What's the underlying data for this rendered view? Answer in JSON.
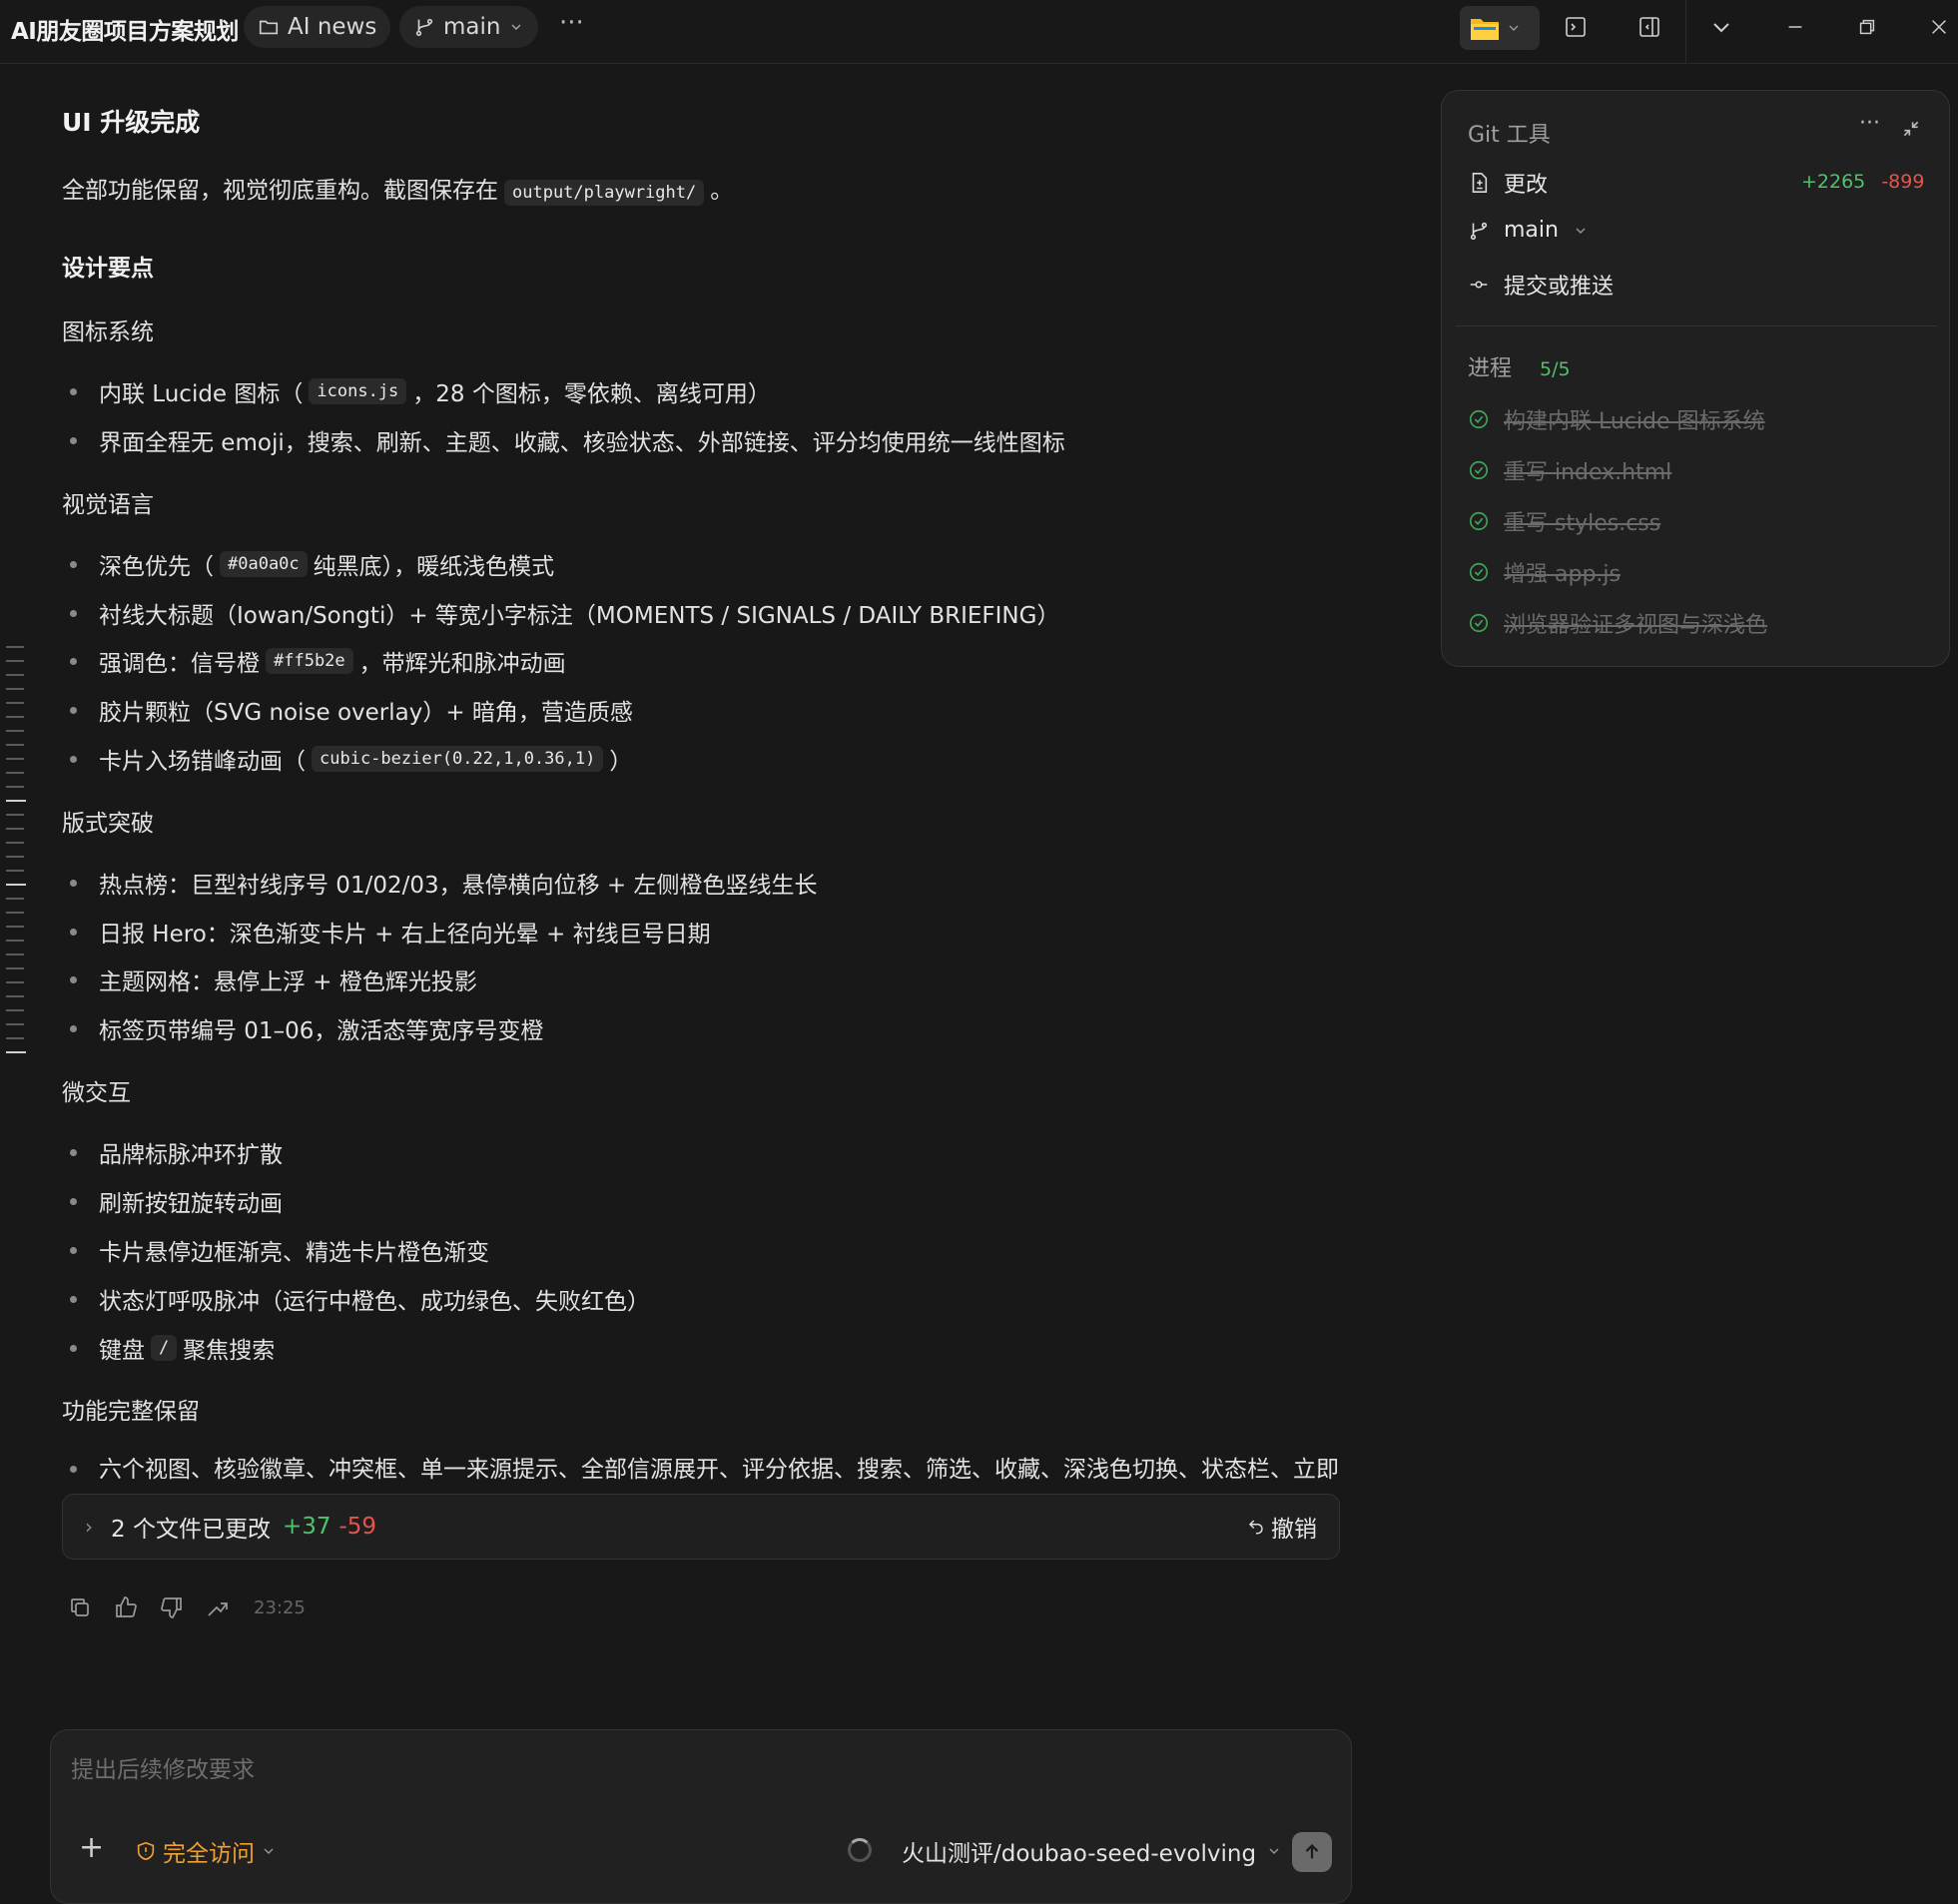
{
  "titlebar": {
    "project": "AI朋友圈项目方案规划",
    "folder": "AI news",
    "branch": "main",
    "more": "···"
  },
  "content": {
    "h1": "UI 升级完成",
    "intro_before": "全部功能保留，视觉彻底重构。截图保存在",
    "intro_code": "output/playwright/",
    "intro_after": "。",
    "h2": "设计要点",
    "sections": {
      "icons": {
        "title": "图标系统",
        "i1_a": "内联 Lucide 图标（",
        "i1_code": "icons.js",
        "i1_b": "，28 个图标，零依赖、离线可用）",
        "i2": "界面全程无 emoji，搜索、刷新、主题、收藏、核验状态、外部链接、评分均使用统一线性图标"
      },
      "visual": {
        "title": "视觉语言",
        "v1_a": "深色优先（",
        "v1_code": "#0a0a0c",
        "v1_b": "纯黑底），暖纸浅色模式",
        "v2": "衬线大标题（Iowan/Songti）+ 等宽小字标注（MOMENTS / SIGNALS / DAILY BRIEFING）",
        "v3_a": "强调色：信号橙",
        "v3_code": "#ff5b2e",
        "v3_b": "，带辉光和脉冲动画",
        "v4": "胶片颗粒（SVG noise overlay）+ 暗角，营造质感",
        "v5_a": "卡片入场错峰动画（",
        "v5_code": "cubic-bezier(0.22,1,0.36,1)",
        "v5_b": "）"
      },
      "layout": {
        "title": "版式突破",
        "l1": "热点榜：巨型衬线序号 01/02/03，悬停横向位移 + 左侧橙色竖线生长",
        "l2": "日报 Hero：深色渐变卡片 + 右上径向光晕 + 衬线巨号日期",
        "l3": "主题网格：悬停上浮 + 橙色辉光投影",
        "l4": "标签页带编号 01–06，激活态等宽序号变橙"
      },
      "micro": {
        "title": "微交互",
        "m1": "品牌标脉冲环扩散",
        "m2": "刷新按钮旋转动画",
        "m3": "卡片悬停边框渐亮、精选卡片橙色渐变",
        "m4": "状态灯呼吸脉冲（运行中橙色、成功绿色、失败红色）",
        "m5_a": "键盘",
        "m5_code": "/",
        "m5_b": "聚焦搜索"
      },
      "features": {
        "title": "功能完整保留",
        "f1": "六个视图、核验徽章、冲突框、单一来源提示、全部信源展开、评分依据、搜索、筛选、收藏、深浅色切换、状态栏、立即刷新按钮、演示模式——全部正常工作。"
      }
    }
  },
  "changes": {
    "label": "2 个文件已更改",
    "added": "+37",
    "removed": "-59",
    "undo": "撤销"
  },
  "actions": {
    "time": "23:25"
  },
  "composer": {
    "placeholder": "提出后续修改要求",
    "access": "完全访问",
    "model": "火山测评/doubao-seed-evolving"
  },
  "git_panel": {
    "title": "Git 工具",
    "changes_label": "更改",
    "added": "+2265",
    "removed": "-899",
    "branch": "main",
    "commit_label": "提交或推送",
    "progress_label": "进程",
    "progress_count": "5/5",
    "tasks": [
      "构建内联 Lucide 图标系统",
      "重写 index.html",
      "重写 styles.css",
      "增强 app.js",
      "浏览器验证多视图与深浅色"
    ]
  },
  "colors": {
    "accent_green": "#4fc26b",
    "accent_red": "#e2554f",
    "access_orange": "#f0a030"
  }
}
